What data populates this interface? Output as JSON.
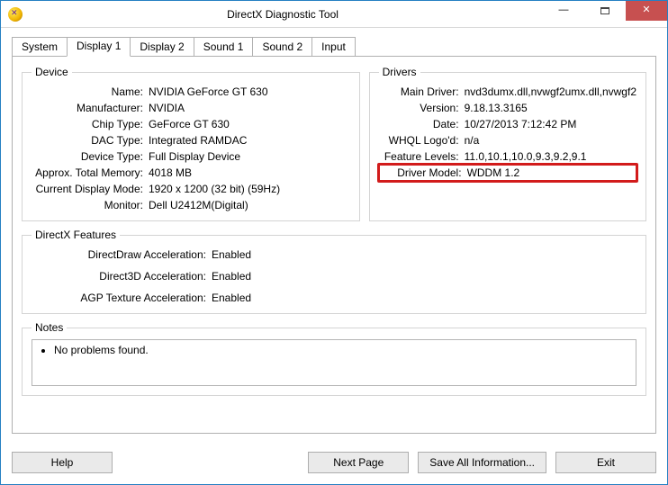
{
  "window": {
    "title": "DirectX Diagnostic Tool"
  },
  "tabs": [
    {
      "label": "System"
    },
    {
      "label": "Display 1"
    },
    {
      "label": "Display 2"
    },
    {
      "label": "Sound 1"
    },
    {
      "label": "Sound 2"
    },
    {
      "label": "Input"
    }
  ],
  "active_tab": "Display 1",
  "device": {
    "legend": "Device",
    "rows": [
      {
        "k": "Name:",
        "v": "NVIDIA GeForce GT 630"
      },
      {
        "k": "Manufacturer:",
        "v": "NVIDIA"
      },
      {
        "k": "Chip Type:",
        "v": "GeForce GT 630"
      },
      {
        "k": "DAC Type:",
        "v": "Integrated RAMDAC"
      },
      {
        "k": "Device Type:",
        "v": "Full Display Device"
      },
      {
        "k": "Approx. Total Memory:",
        "v": "4018 MB"
      },
      {
        "k": "Current Display Mode:",
        "v": "1920 x 1200 (32 bit) (59Hz)"
      },
      {
        "k": "Monitor:",
        "v": "Dell U2412M(Digital)"
      }
    ]
  },
  "drivers": {
    "legend": "Drivers",
    "rows": [
      {
        "k": "Main Driver:",
        "v": "nvd3dumx.dll,nvwgf2umx.dll,nvwgf2"
      },
      {
        "k": "Version:",
        "v": "9.18.13.3165"
      },
      {
        "k": "Date:",
        "v": "10/27/2013 7:12:42 PM"
      },
      {
        "k": "WHQL Logo'd:",
        "v": "n/a"
      },
      {
        "k": "Feature Levels:",
        "v": "11.0,10.1,10.0,9.3,9.2,9.1"
      },
      {
        "k": "Driver Model:",
        "v": "WDDM 1.2"
      }
    ],
    "highlight_index": 5
  },
  "features": {
    "legend": "DirectX Features",
    "rows": [
      {
        "k": "DirectDraw Acceleration:",
        "v": "Enabled"
      },
      {
        "k": "Direct3D Acceleration:",
        "v": "Enabled"
      },
      {
        "k": "AGP Texture Acceleration:",
        "v": "Enabled"
      }
    ]
  },
  "notes": {
    "legend": "Notes",
    "items": [
      "No problems found."
    ]
  },
  "buttons": {
    "help": "Help",
    "next": "Next Page",
    "save": "Save All Information...",
    "exit": "Exit"
  }
}
